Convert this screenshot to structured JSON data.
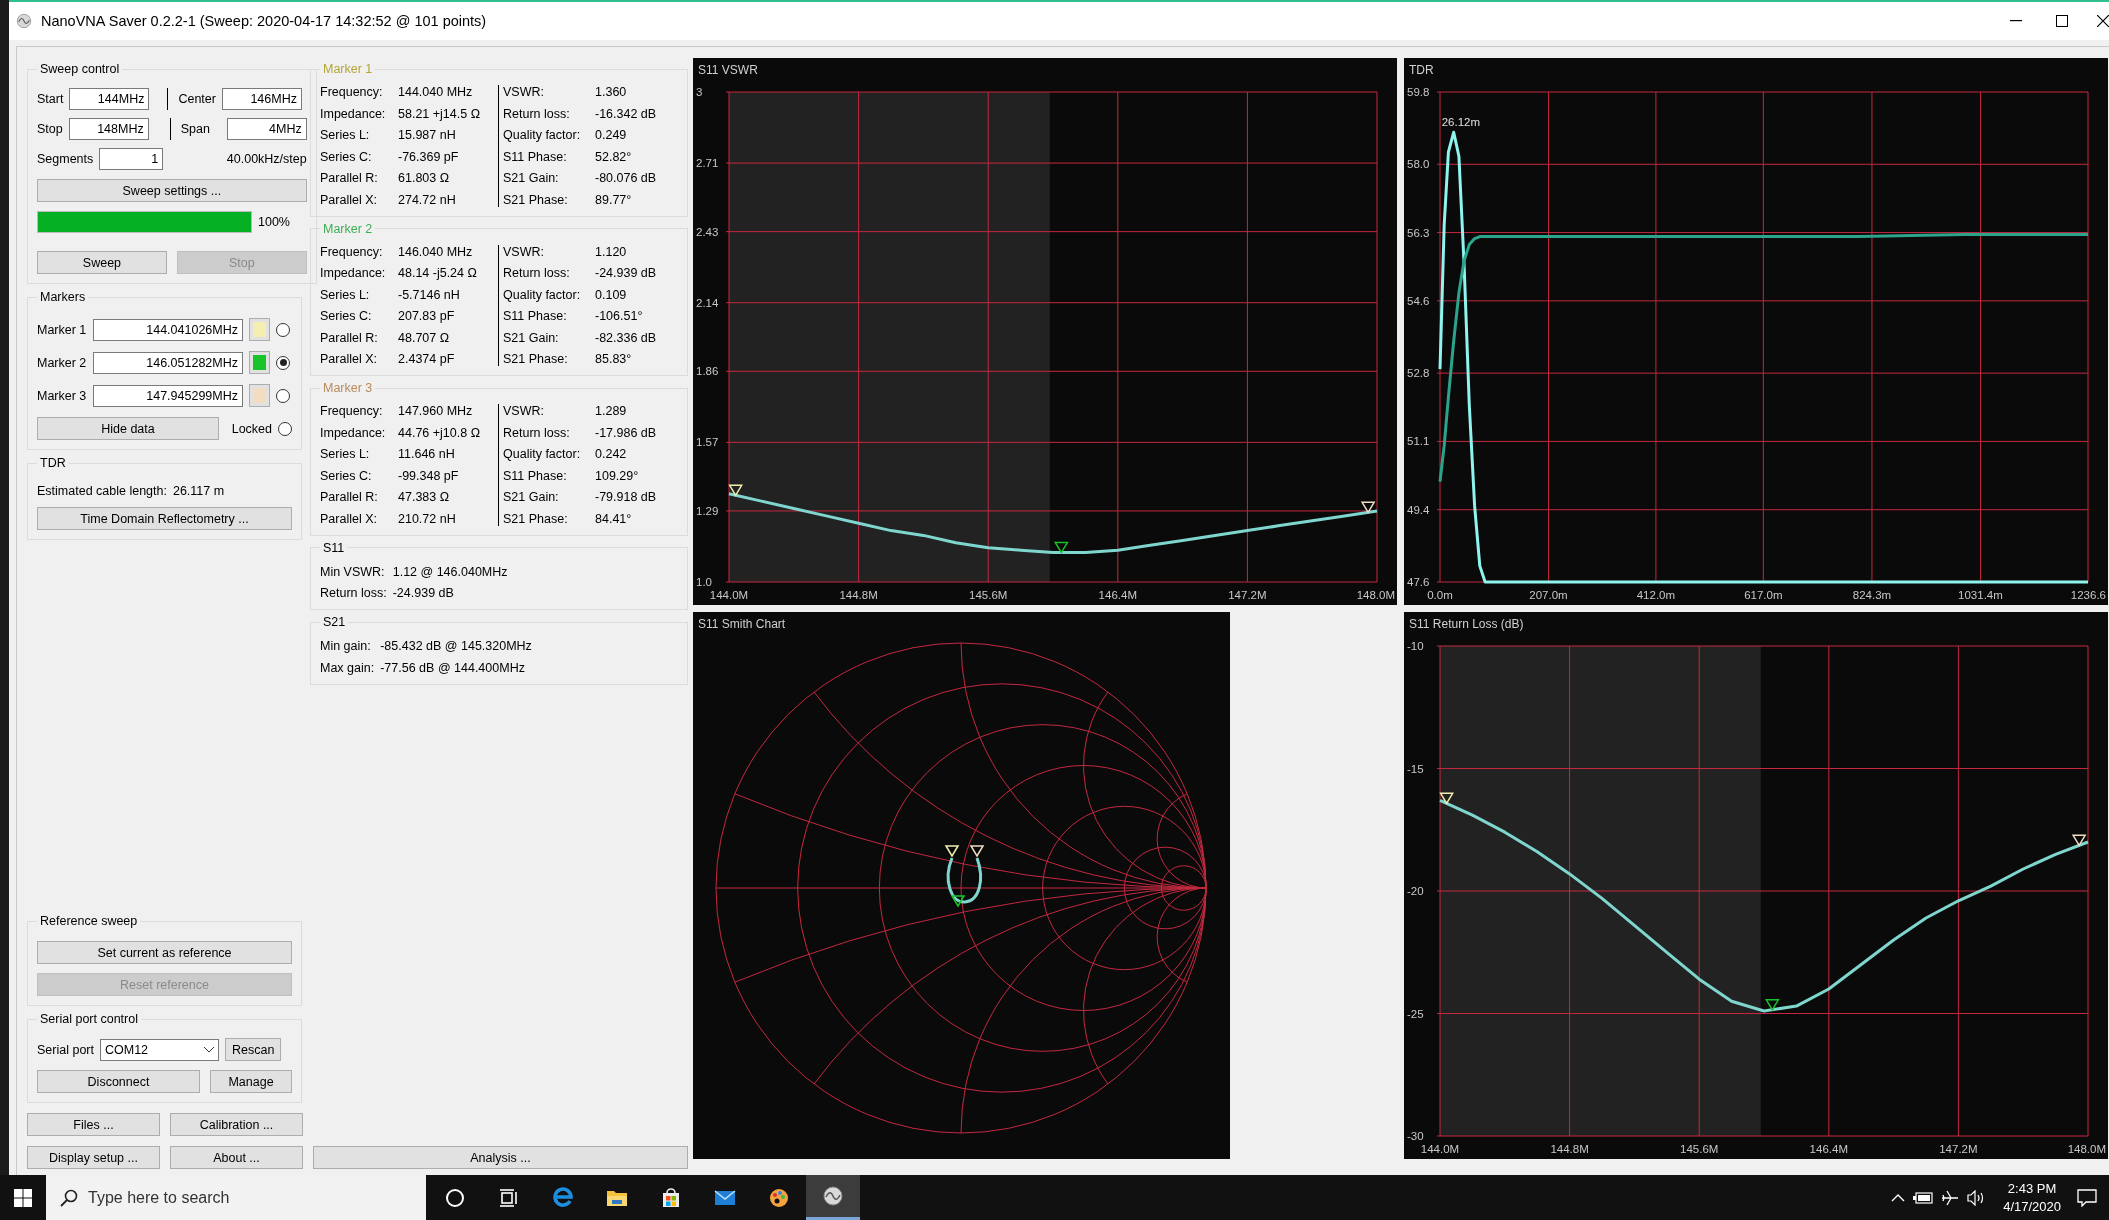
{
  "window": {
    "title": "NanoVNA Saver 0.2.2-1 (Sweep: 2020-04-17 14:32:52 @ 101 points)"
  },
  "sweep_control": {
    "title": "Sweep control",
    "start": {
      "label": "Start",
      "value": "144MHz"
    },
    "center": {
      "label": "Center",
      "value": "146MHz"
    },
    "stop": {
      "label": "Stop",
      "value": "148MHz"
    },
    "span": {
      "label": "Span",
      "value": "4MHz"
    },
    "segments": {
      "label": "Segments",
      "value": "1"
    },
    "step": "40.00kHz/step",
    "settings_button": "Sweep settings ...",
    "progress": {
      "level": 1.0,
      "reading": "100%"
    },
    "sweep_button": {
      "label": "Sweep",
      "disabled": false
    },
    "stop_button": {
      "label": "Stop",
      "disabled": true
    }
  },
  "markers": {
    "title": "Markers",
    "items": [
      {
        "label": "Marker 1",
        "value": "144.041026MHz",
        "color": "#f4eeb0",
        "selected": false
      },
      {
        "label": "Marker 2",
        "value": "146.051282MHz",
        "color": "#18c42a",
        "selected": true
      },
      {
        "label": "Marker 3",
        "value": "147.945299MHz",
        "color": "#f2dcc2",
        "selected": false
      }
    ],
    "hide_button": "Hide data",
    "locked": {
      "label": "Locked",
      "checked": false
    }
  },
  "tdr": {
    "title": "TDR",
    "cable_label": "Estimated cable length:",
    "cable_value": "26.117 m",
    "button": "Time Domain Reflectometry ..."
  },
  "reference_sweep": {
    "title": "Reference sweep",
    "set_button": {
      "label": "Set current as reference",
      "disabled": false
    },
    "reset_button": {
      "label": "Reset reference",
      "disabled": true
    }
  },
  "serial_port": {
    "title": "Serial port control",
    "label": "Serial port",
    "port": "COM12",
    "rescan_button": "Rescan",
    "disconnect_button": "Disconnect",
    "manage_button": "Manage"
  },
  "bottom_buttons": [
    [
      "Files ...",
      "Calibration ..."
    ],
    [
      "Display setup ...",
      "About ...",
      "Analysis ..."
    ]
  ],
  "marker_data": [
    {
      "title": "Marker 1",
      "color": "#b3a53a",
      "left": [
        {
          "label": "Frequency:",
          "value": "144.040 MHz"
        },
        {
          "label": "Impedance:",
          "value": "58.21 +j14.5 Ω"
        },
        {
          "label": "Series L:",
          "value": "15.987 nH"
        },
        {
          "label": "Series C:",
          "value": "-76.369 pF"
        },
        {
          "label": "Parallel R:",
          "value": "61.803 Ω"
        },
        {
          "label": "Parallel X:",
          "value": "274.72 nH"
        }
      ],
      "right": [
        {
          "label": "VSWR:",
          "value": "1.360"
        },
        {
          "label": "Return loss:",
          "value": "-16.342 dB"
        },
        {
          "label": "Quality factor:",
          "value": "0.249"
        },
        {
          "label": "S11 Phase:",
          "value": "52.82°"
        },
        {
          "label": "S21 Gain:",
          "value": "-80.076 dB"
        },
        {
          "label": "S21 Phase:",
          "value": "89.77°"
        }
      ]
    },
    {
      "title": "Marker 2",
      "color": "#3faf55",
      "left": [
        {
          "label": "Frequency:",
          "value": "146.040 MHz"
        },
        {
          "label": "Impedance:",
          "value": "48.14 -j5.24 Ω"
        },
        {
          "label": "Series L:",
          "value": "-5.7146 nH"
        },
        {
          "label": "Series C:",
          "value": "207.83 pF"
        },
        {
          "label": "Parallel R:",
          "value": "48.707 Ω"
        },
        {
          "label": "Parallel X:",
          "value": "2.4374 pF"
        }
      ],
      "right": [
        {
          "label": "VSWR:",
          "value": "1.120"
        },
        {
          "label": "Return loss:",
          "value": "-24.939 dB"
        },
        {
          "label": "Quality factor:",
          "value": "0.109"
        },
        {
          "label": "S11 Phase:",
          "value": "-106.51°"
        },
        {
          "label": "S21 Gain:",
          "value": "-82.336 dB"
        },
        {
          "label": "S21 Phase:",
          "value": "85.83°"
        }
      ]
    },
    {
      "title": "Marker 3",
      "color": "#b98a5c",
      "left": [
        {
          "label": "Frequency:",
          "value": "147.960 MHz"
        },
        {
          "label": "Impedance:",
          "value": "44.76 +j10.8 Ω"
        },
        {
          "label": "Series L:",
          "value": "11.646 nH"
        },
        {
          "label": "Series C:",
          "value": "-99.348 pF"
        },
        {
          "label": "Parallel R:",
          "value": "47.383 Ω"
        },
        {
          "label": "Parallel X:",
          "value": "210.72 nH"
        }
      ],
      "right": [
        {
          "label": "VSWR:",
          "value": "1.289"
        },
        {
          "label": "Return loss:",
          "value": "-17.986 dB"
        },
        {
          "label": "Quality factor:",
          "value": "0.242"
        },
        {
          "label": "S11 Phase:",
          "value": "109.29°"
        },
        {
          "label": "S21 Gain:",
          "value": "-79.918 dB"
        },
        {
          "label": "S21 Phase:",
          "value": "84.41°"
        }
      ]
    }
  ],
  "s11": {
    "title": "S11",
    "rows": [
      {
        "label": "Min VSWR:",
        "value": "1.12 @ 146.040MHz"
      },
      {
        "label": "Return loss:",
        "value": "-24.939 dB"
      }
    ]
  },
  "s21": {
    "title": "S21",
    "rows": [
      {
        "label": "Min gain:",
        "value": "-85.432 dB @ 145.320MHz"
      },
      {
        "label": "Max gain:",
        "value": "-77.56 dB @ 144.400MHz"
      }
    ]
  },
  "charts": [
    {
      "kind": "sweep",
      "title": "S11 VSWR",
      "chart_data": {
        "type": "line",
        "grid": true,
        "x": [
          144.0,
          144.2,
          144.4,
          144.6,
          144.8,
          145.0,
          145.2,
          145.4,
          145.6,
          145.8,
          146.0,
          146.2,
          146.4,
          146.6,
          146.8,
          147.0,
          147.2,
          147.4,
          147.6,
          147.8,
          148.0
        ],
        "series": [
          {
            "color": "#7fd6cf",
            "values": [
              1.36,
              1.33,
              1.3,
              1.27,
              1.24,
              1.21,
              1.19,
              1.16,
              1.14,
              1.13,
              1.12,
              1.12,
              1.13,
              1.15,
              1.17,
              1.19,
              1.21,
              1.23,
              1.25,
              1.27,
              1.29
            ]
          }
        ],
        "xlim": [
          144,
          148
        ],
        "ylim": [
          1,
          3
        ],
        "xticks": [
          {
            "value": 144,
            "label": "144.0M"
          },
          {
            "value": 144.8,
            "label": "144.8M"
          },
          {
            "value": 145.6,
            "label": "145.6M"
          },
          {
            "value": 146.4,
            "label": "146.4M"
          },
          {
            "value": 147.2,
            "label": "147.2M"
          },
          {
            "value": 148,
            "label": "148.0M"
          }
        ],
        "yticks": [
          {
            "value": 1,
            "label": "1.0"
          },
          {
            "value": 1.29,
            "label": "1.29"
          },
          {
            "value": 1.57,
            "label": "1.57"
          },
          {
            "value": 1.86,
            "label": "1.86"
          },
          {
            "value": 2.14,
            "label": "2.14"
          },
          {
            "value": 2.43,
            "label": "2.43"
          },
          {
            "value": 2.71,
            "label": "2.71"
          },
          {
            "value": 3,
            "label": "3"
          }
        ]
      }
    },
    {
      "kind": "distance",
      "title": "TDR",
      "chart_data": {
        "type": "line",
        "grid": true,
        "x": [
          0,
          8,
          16,
          26.12,
          36,
          46,
          56,
          66,
          76,
          86,
          100,
          200,
          400,
          600,
          800,
          1000,
          1236.6
        ],
        "series": [
          {
            "color": "#8ff3ee",
            "values": [
              52.9,
              56.5,
              58.3,
              58.8,
              58.2,
              55.5,
              52.0,
              49.5,
              48.0,
              47.6,
              47.6,
              47.6,
              47.6,
              47.6,
              47.6,
              47.6,
              47.6
            ]
          },
          {
            "color": "#2ba48b",
            "values": [
              50.1,
              51.0,
              52.2,
              53.6,
              54.8,
              55.6,
              56.0,
              56.15,
              56.2,
              56.2,
              56.2,
              56.2,
              56.2,
              56.2,
              56.2,
              56.25,
              56.25
            ]
          }
        ],
        "xlim": [
          0,
          1236.6
        ],
        "ylim": [
          47.6,
          59.8
        ],
        "xticks": [
          {
            "value": 0,
            "label": "0.0m"
          },
          {
            "value": 207,
            "label": "207.0m"
          },
          {
            "value": 412,
            "label": "412.0m"
          },
          {
            "value": 617,
            "label": "617.0m"
          },
          {
            "value": 824.3,
            "label": "824.3m"
          },
          {
            "value": 1031.4,
            "label": "1031.4m"
          },
          {
            "value": 1236.6,
            "label": "1236.6"
          }
        ],
        "yticks": [
          {
            "value": 47.6,
            "label": "47.6"
          },
          {
            "value": 49.4,
            "label": "49.4"
          },
          {
            "value": 51.1,
            "label": "51.1"
          },
          {
            "value": 52.8,
            "label": "52.8"
          },
          {
            "value": 54.6,
            "label": "54.6"
          },
          {
            "value": 56.3,
            "label": "56.3"
          },
          {
            "value": 58.0,
            "label": "58.0"
          },
          {
            "value": 59.8,
            "label": "59.8"
          }
        ],
        "annotations": [
          "26.12m"
        ]
      }
    },
    {
      "kind": "smith",
      "title": "S11 Smith Chart"
    },
    {
      "kind": "sweep",
      "title": "S11 Return Loss (dB)",
      "chart_data": {
        "type": "line",
        "grid": true,
        "x": [
          144.0,
          144.2,
          144.4,
          144.6,
          144.8,
          145.0,
          145.2,
          145.4,
          145.6,
          145.8,
          146.0,
          146.2,
          146.4,
          146.6,
          146.8,
          147.0,
          147.2,
          147.4,
          147.6,
          147.8,
          148.0
        ],
        "series": [
          {
            "color": "#7fd6cf",
            "values": [
              -16.3,
              -16.9,
              -17.6,
              -18.4,
              -19.3,
              -20.3,
              -21.4,
              -22.5,
              -23.6,
              -24.5,
              -24.9,
              -24.7,
              -24.0,
              -23.0,
              -22.0,
              -21.1,
              -20.4,
              -19.8,
              -19.1,
              -18.5,
              -18.0
            ]
          }
        ],
        "xlim": [
          144,
          148
        ],
        "ylim": [
          -30,
          -10
        ],
        "xticks": [
          {
            "value": 144,
            "label": "144.0M"
          },
          {
            "value": 144.8,
            "label": "144.8M"
          },
          {
            "value": 145.6,
            "label": "145.6M"
          },
          {
            "value": 146.4,
            "label": "146.4M"
          },
          {
            "value": 147.2,
            "label": "147.2M"
          },
          {
            "value": 148,
            "label": "148.0M"
          }
        ],
        "yticks": [
          {
            "value": -30,
            "label": "-30"
          },
          {
            "value": -25,
            "label": "-25"
          },
          {
            "value": -20,
            "label": "-20"
          },
          {
            "value": -15,
            "label": "-15"
          },
          {
            "value": -10,
            "label": "-10"
          }
        ]
      }
    }
  ],
  "taskbar": {
    "search": {
      "placeholder": "Type here to search"
    },
    "apps": [
      {
        "kind": "cortana",
        "selected": false
      },
      {
        "kind": "task-view",
        "selected": false
      },
      {
        "kind": "browser",
        "selected": false
      },
      {
        "kind": "folder",
        "selected": false
      },
      {
        "kind": "store",
        "selected": false
      },
      {
        "kind": "mail",
        "selected": false
      },
      {
        "kind": "paint",
        "selected": false
      },
      {
        "kind": "nanovna",
        "selected": true
      }
    ],
    "time": "2:43 PM",
    "date": "4/17/2020"
  }
}
